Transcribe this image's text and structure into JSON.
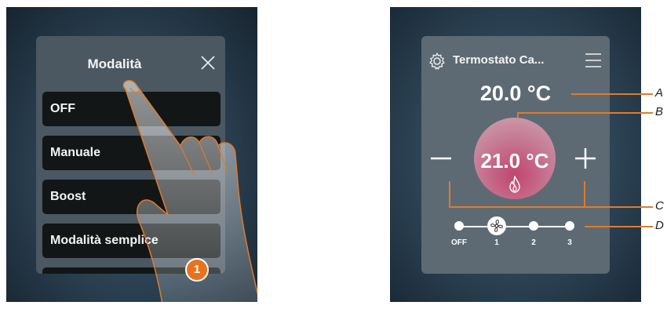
{
  "left": {
    "modal": {
      "title": "Modalità",
      "items": [
        {
          "label": "OFF"
        },
        {
          "label": "Manuale"
        },
        {
          "label": "Boost"
        },
        {
          "label": "Modalità semplice"
        }
      ]
    },
    "step_badge": "1"
  },
  "right": {
    "thermostat": {
      "name": "Termostato Ca...",
      "measured_temp": "20.0 °C",
      "setpoint_temp": "21.0 °C",
      "fan_labels": [
        "OFF",
        "1",
        "2",
        "3"
      ],
      "fan_selected": "1"
    },
    "callouts": [
      "A",
      "B",
      "C",
      "D"
    ]
  },
  "colors": {
    "accent_orange": "#e07b2a",
    "mode_item_bg": "#121617",
    "modal_bg": "#4b5761",
    "dial_pink": "#c2446f"
  }
}
